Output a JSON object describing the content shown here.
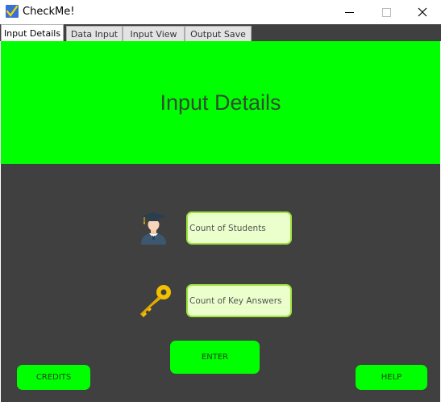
{
  "window": {
    "title": "CheckMe!",
    "icon": "checkmark-app-icon"
  },
  "tabs": [
    {
      "label": "Input Details",
      "active": true
    },
    {
      "label": "Data Input",
      "active": false
    },
    {
      "label": "Input View",
      "active": false
    },
    {
      "label": "Output Save",
      "active": false
    }
  ],
  "header": {
    "title": "Input Details"
  },
  "form": {
    "students": {
      "placeholder": "Count of Students",
      "icon": "student-graduate-icon"
    },
    "key_answers": {
      "placeholder": "Count of Key Answers",
      "icon": "key-icon"
    }
  },
  "buttons": {
    "enter": "ENTER",
    "credits": "CREDITS",
    "help": "HELP"
  },
  "colors": {
    "accent": "#00ff00",
    "background": "#404040",
    "field_fill": "#ebffcc",
    "field_border": "#9ce43a"
  }
}
